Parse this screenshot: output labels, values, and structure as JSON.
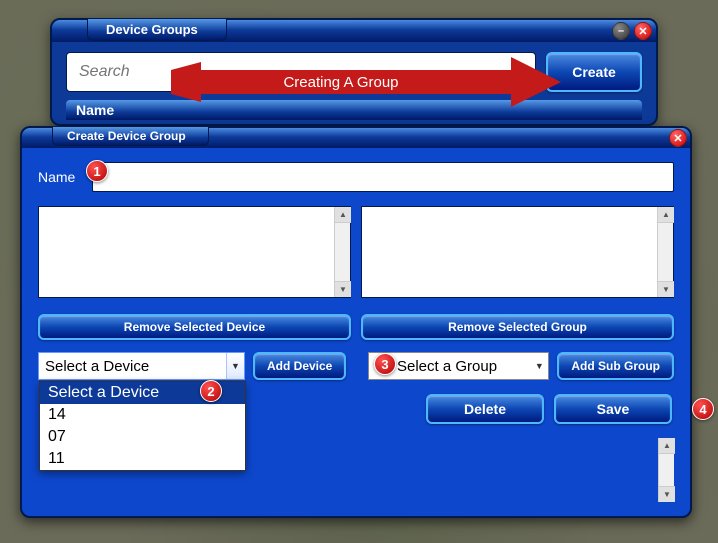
{
  "win1": {
    "title": "Device Groups",
    "search_placeholder": "Search",
    "create_label": "Create",
    "name_header": "Name"
  },
  "arrow_text": "Creating A Group",
  "win2": {
    "title": "Create Device Group",
    "name_label": "Name",
    "name_value": "",
    "remove_device_label": "Remove Selected Device",
    "remove_group_label": "Remove Selected Group",
    "device_select": {
      "selected": "Select a Device",
      "options": [
        "Select a Device",
        "14",
        "07",
        "11"
      ]
    },
    "add_device_label": "Add Device",
    "group_select": {
      "selected": "Select a Group"
    },
    "add_subgroup_label": "Add Sub Group",
    "delete_label": "Delete",
    "save_label": "Save"
  },
  "callouts": {
    "c1": "1",
    "c2": "2",
    "c3": "3",
    "c4": "4"
  }
}
